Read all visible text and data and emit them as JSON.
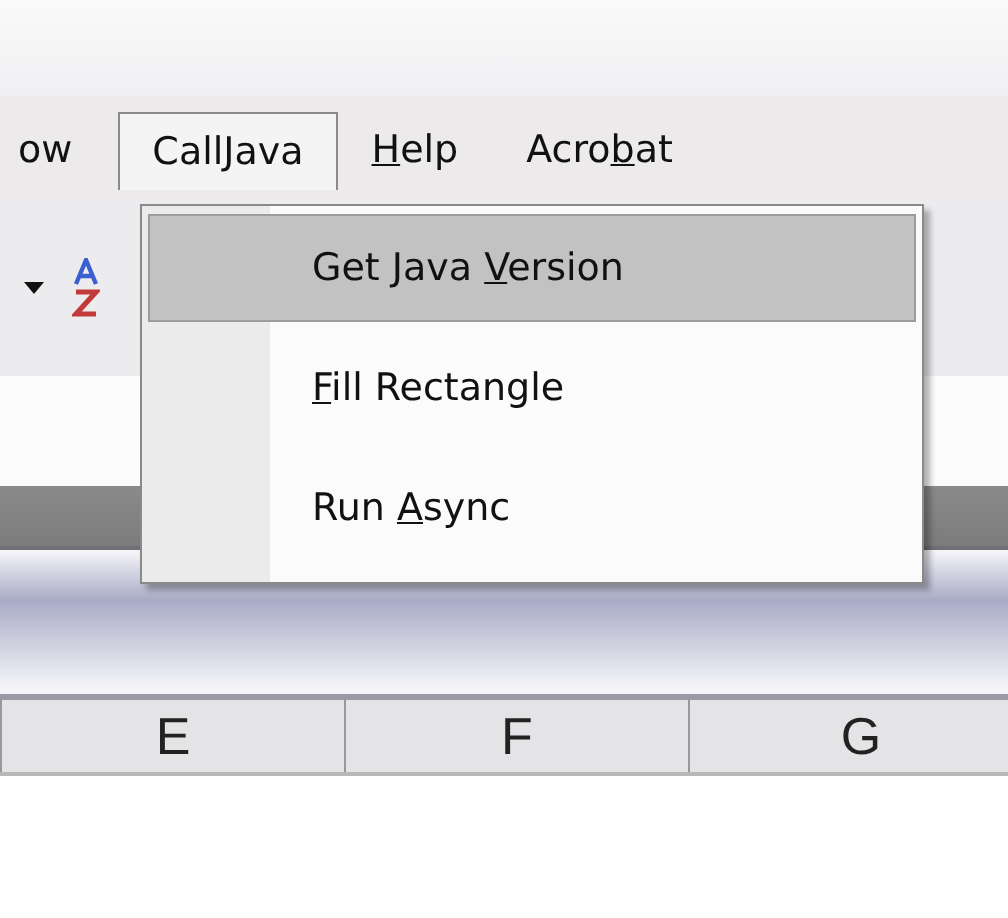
{
  "menu_bar": {
    "items": [
      {
        "label": {
          "text": "ow"
        },
        "selected": false
      },
      {
        "label": {
          "before": "Call",
          "key": "J",
          "after": "ava"
        },
        "selected": true
      },
      {
        "label": {
          "key": "H",
          "after": "elp"
        },
        "selected": false
      },
      {
        "label": {
          "before": "Acro",
          "key": "b",
          "after": "at"
        },
        "selected": false
      }
    ]
  },
  "dropdown": {
    "items": [
      {
        "label": {
          "before": "Get Java ",
          "key": "V",
          "after": "ersion"
        },
        "selected": true
      },
      {
        "label": {
          "key": "F",
          "after": "ill Rectangle"
        },
        "selected": false
      },
      {
        "label": {
          "before": "Run ",
          "key": "A",
          "after": "sync"
        },
        "selected": false
      }
    ]
  },
  "column_headers": [
    "E",
    "F",
    "G"
  ]
}
